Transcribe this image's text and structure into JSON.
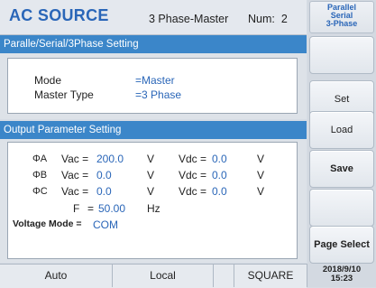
{
  "header": {
    "title": "AC SOURCE",
    "status": "3 Phase-Master",
    "num_label": "Num:",
    "num_value": "2"
  },
  "mode_badge": [
    "Parallel",
    "Serial",
    "3-Phase"
  ],
  "side_buttons": [
    "",
    "Set",
    "Load",
    "Save",
    "",
    "Page Select"
  ],
  "section1": {
    "title": "Paralle/Serial/3Phase Setting",
    "rows": [
      {
        "label": "Mode",
        "value": "=Master"
      },
      {
        "label": "Master Type",
        "value": "=3 Phase"
      }
    ]
  },
  "section2": {
    "title": "Output Parameter Setting",
    "phases": [
      {
        "phase": "ΦA",
        "vac_label": "Vac =",
        "vac": "200.0",
        "vac_unit": "V",
        "vdc_label": "Vdc =",
        "vdc": "0.0",
        "vdc_unit": "V"
      },
      {
        "phase": "ΦB",
        "vac_label": "Vac =",
        "vac": "0.0",
        "vac_unit": "V",
        "vdc_label": "Vdc =",
        "vdc": "0.0",
        "vdc_unit": "V"
      },
      {
        "phase": "ΦC",
        "vac_label": "Vac =",
        "vac": "0.0",
        "vac_unit": "V",
        "vdc_label": "Vdc =",
        "vdc": "0.0",
        "vdc_unit": "V"
      }
    ],
    "freq_label": "F",
    "freq_eq": "=",
    "freq_value": "50.00",
    "freq_unit": "Hz",
    "voltage_mode_label": "Voltage Mode =",
    "voltage_mode_value": "COM"
  },
  "bottom": {
    "cells": [
      "Auto",
      "Local",
      "",
      "SQUARE"
    ],
    "date": "2018/9/10",
    "time": "15:23"
  },
  "colors": {
    "accent": "#2a66b8",
    "section_bar": "#3b86c9"
  }
}
